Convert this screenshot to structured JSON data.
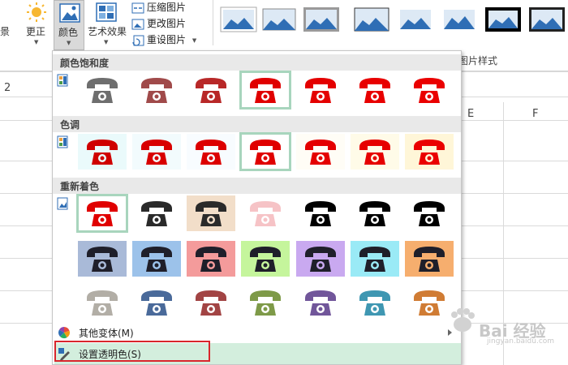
{
  "ribbon": {
    "partial_label": "景",
    "corrections": "更正",
    "color": "颜色",
    "artistic": "艺术效果",
    "compress": "压缩图片",
    "change": "更改图片",
    "reset": "重设图片",
    "styles_group": "图片样式"
  },
  "sheet": {
    "row_label": "2",
    "col_e": "E",
    "col_f": "F"
  },
  "dropdown": {
    "sections": [
      {
        "title": "颜色饱和度",
        "swatches": [
          {
            "bg": "#ffffff",
            "fg": "#6e6e6e",
            "selected": false
          },
          {
            "bg": "#ffffff",
            "fg": "#a04a4a",
            "selected": false
          },
          {
            "bg": "#ffffff",
            "fg": "#b82828",
            "selected": false
          },
          {
            "bg": "#ffffff",
            "fg": "#e00000",
            "selected": true
          },
          {
            "bg": "#ffffff",
            "fg": "#e40000",
            "selected": false
          },
          {
            "bg": "#ffffff",
            "fg": "#e80000",
            "selected": false
          },
          {
            "bg": "#ffffff",
            "fg": "#ea0000",
            "selected": false
          }
        ]
      },
      {
        "title": "色调",
        "swatches": [
          {
            "bg": "#eafafb",
            "fg": "#cf0000",
            "selected": false
          },
          {
            "bg": "#f2fbfd",
            "fg": "#d80000",
            "selected": false
          },
          {
            "bg": "#f8fcff",
            "fg": "#dc0000",
            "selected": false
          },
          {
            "bg": "#ffffff",
            "fg": "#e00000",
            "selected": true
          },
          {
            "bg": "#fffdf6",
            "fg": "#e40000",
            "selected": false
          },
          {
            "bg": "#fffbe8",
            "fg": "#e60000",
            "selected": false
          },
          {
            "bg": "#fff6d8",
            "fg": "#ea0000",
            "selected": false
          }
        ]
      },
      {
        "title": "重新着色",
        "swatches": [
          {
            "bg": "#ffffff",
            "fg": "#e00000",
            "selected": true
          },
          {
            "bg": "#ffffff",
            "fg": "#2a2a2a",
            "selected": false
          },
          {
            "bg": "#f2dec9",
            "fg": "#2a2a2a",
            "selected": false
          },
          {
            "bg": "#ffffff",
            "fg": "#f6c3c6",
            "selected": false
          },
          {
            "bg": "#ffffff",
            "fg": "#000000",
            "selected": false
          },
          {
            "bg": "#ffffff",
            "fg": "#000000",
            "selected": false
          },
          {
            "bg": "#ffffff",
            "fg": "#000000",
            "selected": false
          },
          {
            "bg": "#a9bad8",
            "fg": "#1f1f2a",
            "selected": false
          },
          {
            "bg": "#9cc2ea",
            "fg": "#1f1f2a",
            "selected": false
          },
          {
            "bg": "#f49b9b",
            "fg": "#1f1f2a",
            "selected": false
          },
          {
            "bg": "#c5f59c",
            "fg": "#1f1f2a",
            "selected": false
          },
          {
            "bg": "#c9a9f0",
            "fg": "#1f1f2a",
            "selected": false
          },
          {
            "bg": "#9aeaf6",
            "fg": "#1f1f2a",
            "selected": false
          },
          {
            "bg": "#f6ae6e",
            "fg": "#1f1f2a",
            "selected": false
          },
          {
            "bg": "#ffffff",
            "fg": "#b2aea6",
            "selected": false
          },
          {
            "bg": "#ffffff",
            "fg": "#4a6a9a",
            "selected": false
          },
          {
            "bg": "#ffffff",
            "fg": "#a24444",
            "selected": false
          },
          {
            "bg": "#ffffff",
            "fg": "#7e9a48",
            "selected": false
          },
          {
            "bg": "#ffffff",
            "fg": "#71569a",
            "selected": false
          },
          {
            "bg": "#ffffff",
            "fg": "#3f97b2",
            "selected": false
          },
          {
            "bg": "#ffffff",
            "fg": "#d07c34",
            "selected": false
          }
        ]
      }
    ],
    "more_variations": "其他变体(M)",
    "set_transparent": "设置透明色(S)"
  },
  "watermark": {
    "text": "Bai 经验",
    "url": "jingyan.baidu.com"
  }
}
